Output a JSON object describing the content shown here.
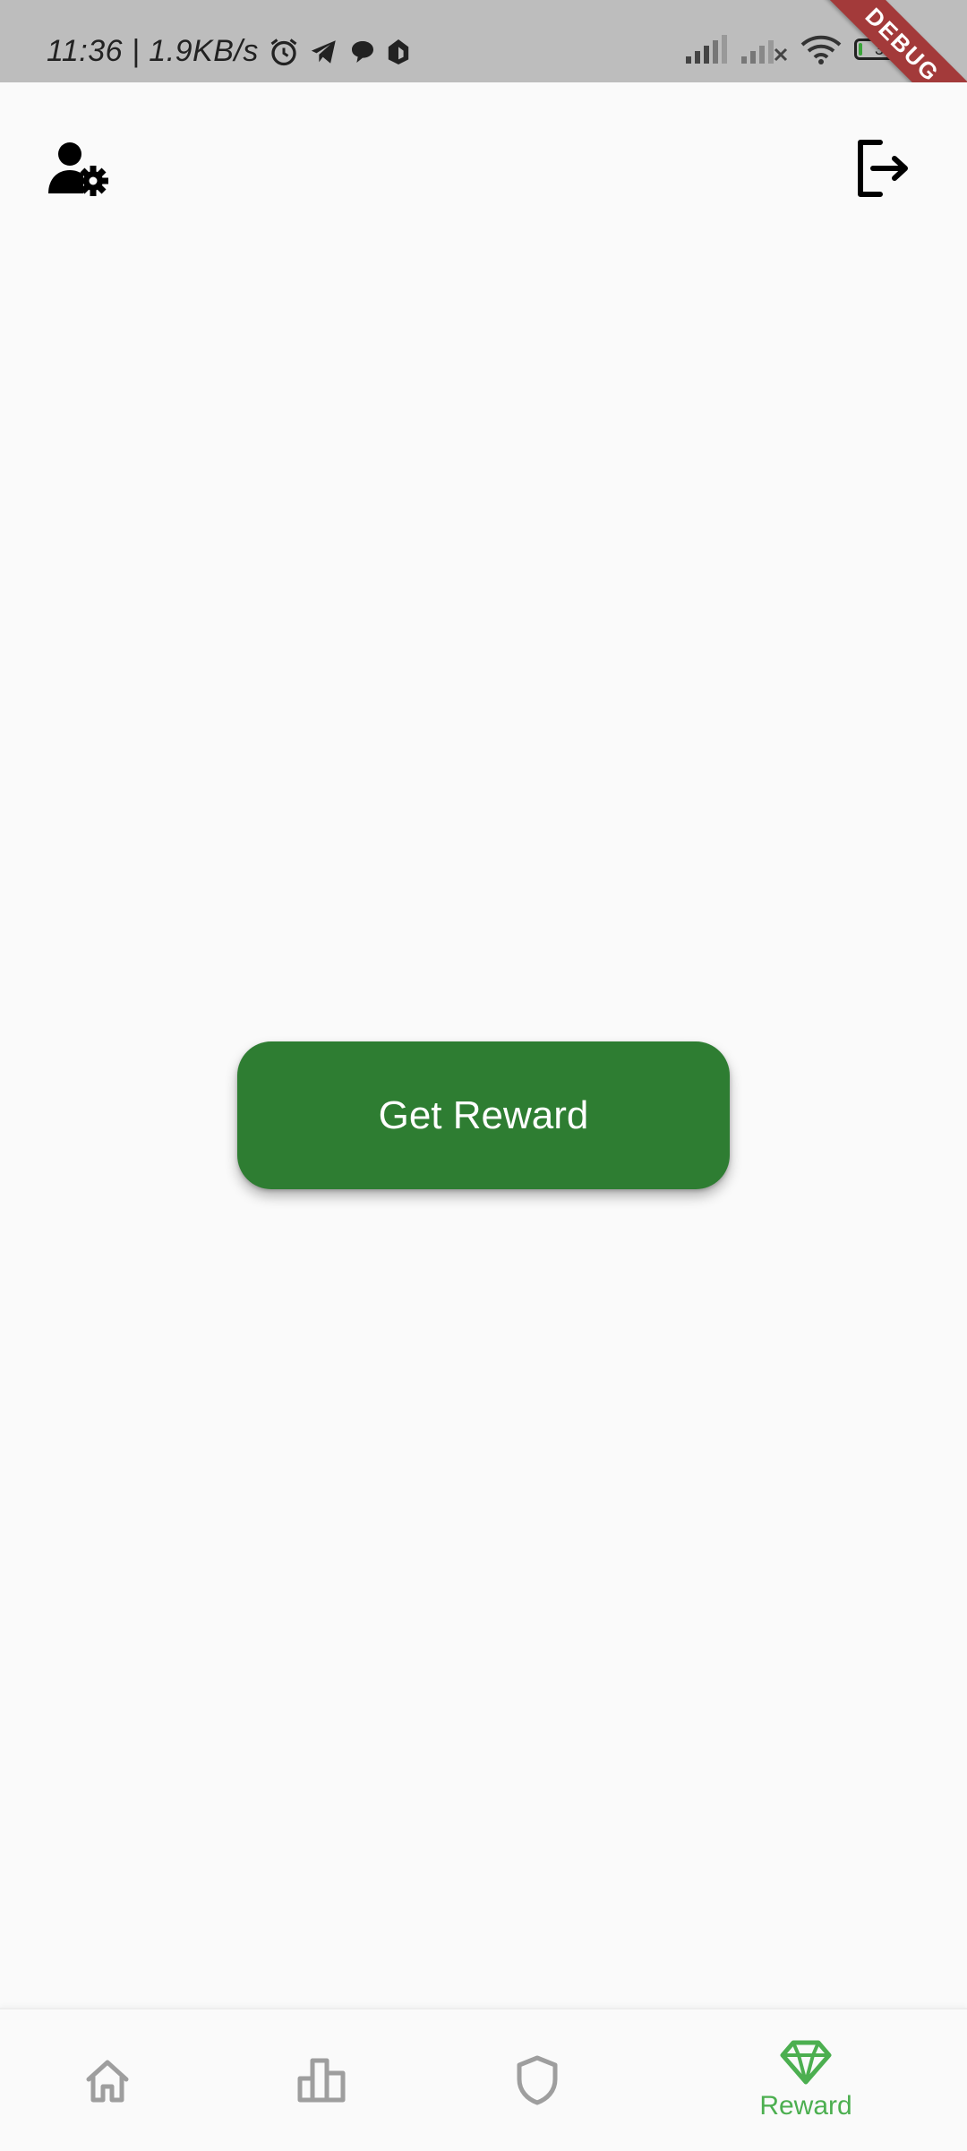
{
  "status_bar": {
    "time_speed": "11:36 | 1.9KB/s",
    "battery_level": "3",
    "debug_label": "DEBUG"
  },
  "header": {
    "left_icon": "user-settings-icon",
    "right_icon": "logout-icon"
  },
  "main": {
    "reward_button_label": "Get Reward",
    "reward_button_color": "#2e7d32"
  },
  "bottom_nav": {
    "items": [
      {
        "icon": "home-icon",
        "label": ""
      },
      {
        "icon": "leaderboard-icon",
        "label": ""
      },
      {
        "icon": "shield-icon",
        "label": ""
      },
      {
        "icon": "diamond-icon",
        "label": "Reward",
        "active": true
      }
    ],
    "active_color": "#4caf50",
    "inactive_color": "#9e9e9e"
  }
}
